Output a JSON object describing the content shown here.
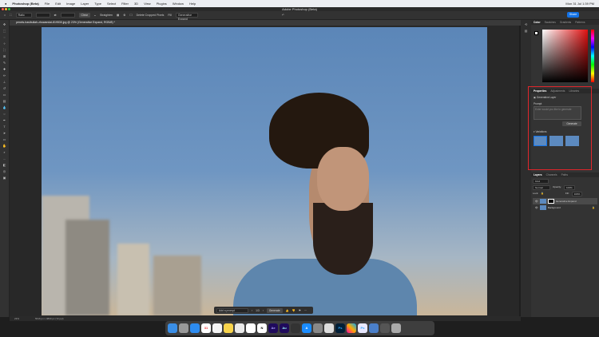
{
  "menubar": {
    "apple": "",
    "app": "Photoshop (Beta)",
    "items": [
      "File",
      "Edit",
      "Image",
      "Layer",
      "Type",
      "Select",
      "Filter",
      "3D",
      "View",
      "Plugins",
      "Window",
      "Help"
    ],
    "clock": "Mon 31 Jul 1:39 PM"
  },
  "window": {
    "title": "Adobe Photoshop (Beta)"
  },
  "options": {
    "ratio": "Ratio",
    "clear": "Clear",
    "straighten": "Straighten",
    "delete_cropped": "Delete Cropped Pixels",
    "fill": "Fill",
    "fill_value": "Generative Expand",
    "share": "Share"
  },
  "document": {
    "tab": "pexels-hasibullah-zhowandai-819530.jpg @ 23% (Generative Expand, RGB/8) *"
  },
  "color_panel": {
    "tabs": [
      "Color",
      "Swatches",
      "Gradients",
      "Patterns"
    ]
  },
  "properties": {
    "tabs": [
      "Properties",
      "Adjustments",
      "Libraries"
    ],
    "layer_type": "Generative Layer",
    "prompt_label": "Prompt",
    "prompt_placeholder": "Enter would you like to generate",
    "generate": "Generate",
    "variations": "Variations"
  },
  "layers": {
    "tabs": [
      "Layers",
      "Channels",
      "Paths"
    ],
    "kind": "Kind",
    "blend": "Normal",
    "opacity_label": "Opacity:",
    "opacity": "100%",
    "lock_label": "Lock:",
    "fill_label": "Fill:",
    "fill": "100%",
    "items": [
      {
        "name": "Generative Expand"
      },
      {
        "name": "Background"
      }
    ]
  },
  "genbar": {
    "placeholder": "Add a prompt",
    "count": "1/3",
    "generate": "Generate"
  },
  "status": {
    "zoom": "23%",
    "size": "5616 px x 4800 px (72 ppi)"
  },
  "dock": {
    "apps": [
      "Finder",
      "Launchpad",
      "Safari",
      "Calendar",
      "Reminders",
      "Notes",
      "Chrome",
      "Slack",
      "Notion",
      "Ae",
      "Au",
      "Final Cut",
      "App Store",
      "Settings",
      "Mixer",
      "Ps",
      "Photos",
      "Ps Beta",
      "Preview",
      "Downloads",
      "Trash"
    ]
  }
}
